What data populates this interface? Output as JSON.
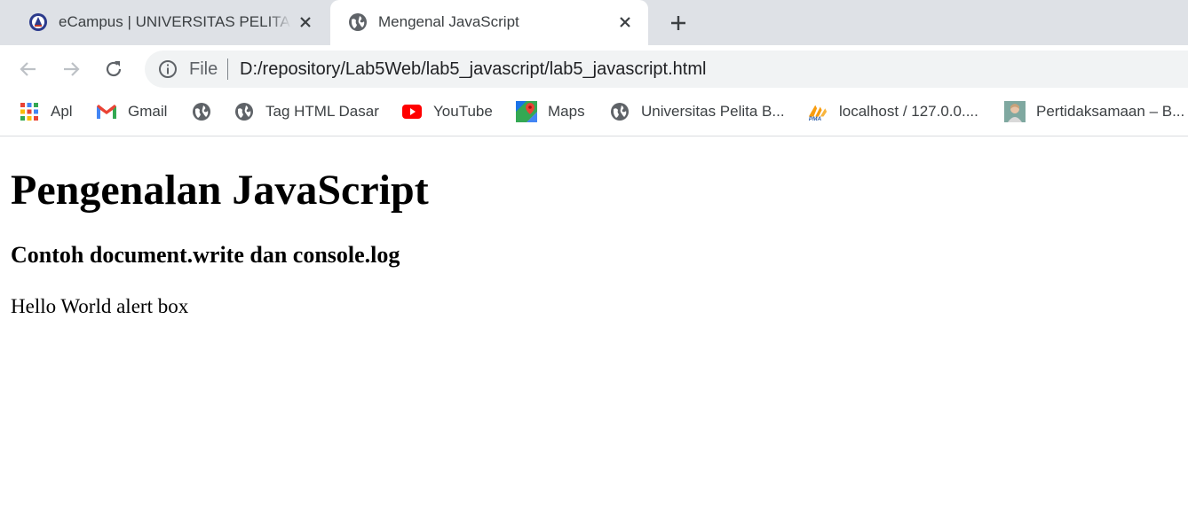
{
  "tabs": [
    {
      "title": "eCampus | UNIVERSITAS PELITA BANGSA",
      "favicon": "university-seal-icon",
      "active": false
    },
    {
      "title": "Mengenal JavaScript",
      "favicon": "globe-icon",
      "active": true
    }
  ],
  "toolbar": {
    "scheme_label": "File",
    "url": "D:/repository/Lab5Web/lab5_javascript/lab5_javascript.html"
  },
  "bookmarks": [
    {
      "label": "Apl",
      "icon": "apps-grid-icon"
    },
    {
      "label": "Gmail",
      "icon": "gmail-icon"
    },
    {
      "label": "",
      "icon": "globe-icon"
    },
    {
      "label": "Tag HTML Dasar",
      "icon": "globe-icon"
    },
    {
      "label": "YouTube",
      "icon": "youtube-icon"
    },
    {
      "label": "Maps",
      "icon": "maps-icon"
    },
    {
      "label": "Universitas Pelita B...",
      "icon": "globe-icon"
    },
    {
      "label": "localhost / 127.0.0....",
      "icon": "phpmyadmin-icon"
    },
    {
      "label": "Pertidaksamaan – B...",
      "icon": "portrait-icon"
    }
  ],
  "page": {
    "heading": "Pengenalan JavaScript",
    "subheading": "Contoh document.write dan console.log",
    "body_text": "Hello World alert box"
  },
  "colors": {
    "tabstrip_bg": "#dee1e6",
    "omnibox_bg": "#f1f3f4",
    "icon_gray": "#5f6368"
  }
}
